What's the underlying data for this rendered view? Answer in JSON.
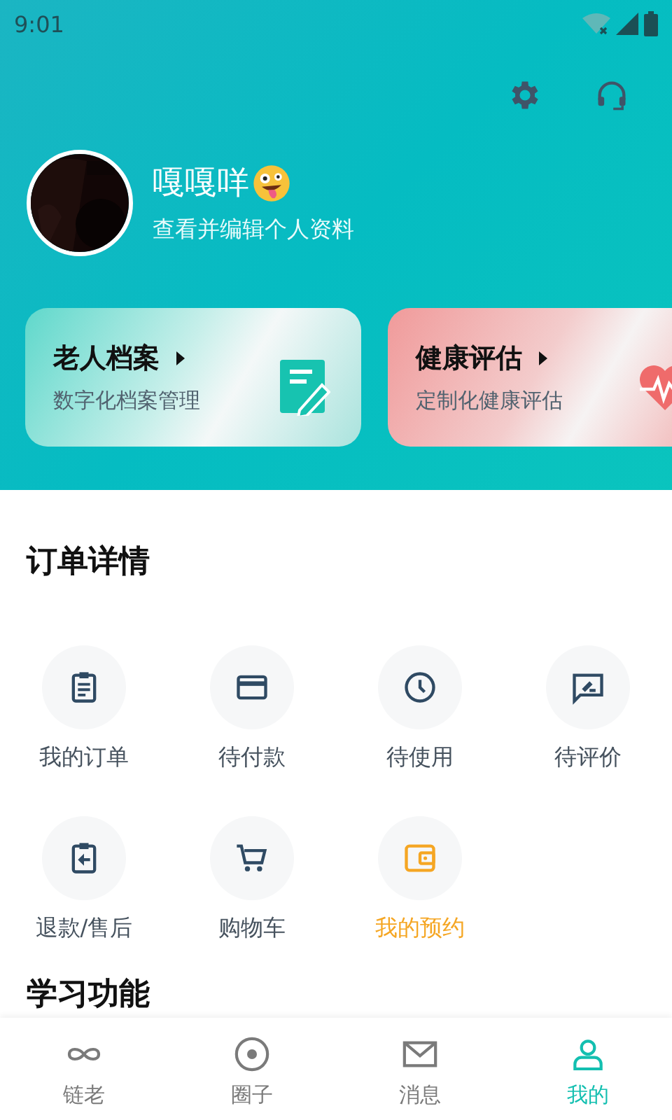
{
  "status_bar": {
    "time": "9:01"
  },
  "profile": {
    "name": "嘎嘎咩",
    "subtitle": "查看并编辑个人资料"
  },
  "cards": [
    {
      "kind": "archive",
      "title": "老人档案",
      "subtitle": "数字化档案管理"
    },
    {
      "kind": "health",
      "title": "健康评估",
      "subtitle": "定制化健康评估"
    }
  ],
  "orders": {
    "title": "订单详情",
    "items": [
      {
        "label": "我的订单",
        "highlighted": false
      },
      {
        "label": "待付款",
        "highlighted": false
      },
      {
        "label": "待使用",
        "highlighted": false
      },
      {
        "label": "待评价",
        "highlighted": false
      },
      {
        "label": "退款/售后",
        "highlighted": false
      },
      {
        "label": "购物车",
        "highlighted": false
      },
      {
        "label": "我的预约",
        "highlighted": true
      }
    ]
  },
  "next_section": {
    "title": "学习功能"
  },
  "tab_bar": [
    {
      "label": "链老",
      "selected": false
    },
    {
      "label": "圈子",
      "selected": false
    },
    {
      "label": "消息",
      "selected": false
    },
    {
      "label": "我的",
      "selected": true
    }
  ]
}
